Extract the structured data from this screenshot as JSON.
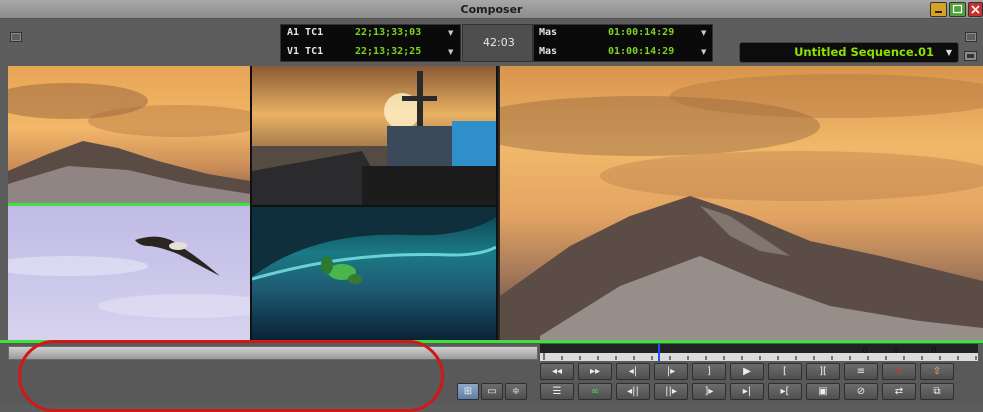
{
  "window": {
    "title": "Composer"
  },
  "source_tc": {
    "rows": [
      {
        "track": "A1 TC1",
        "value": "22;13;33;03"
      },
      {
        "track": "V1 TC1",
        "value": "22;13;32;25"
      }
    ],
    "center": "42:03"
  },
  "record_tc": {
    "rows": [
      {
        "track": "Mas",
        "value": "01:00:14:29"
      },
      {
        "track": "Mas",
        "value": "01:00:14:29"
      }
    ]
  },
  "sequence": {
    "name": "Untitled Sequence.01"
  },
  "ruler": {
    "marks": [
      "0",
      "0",
      "0"
    ]
  },
  "colors": {
    "accent_green": "#3ee13e",
    "timecode_green": "#7ed321",
    "annotation_red": "#d11717"
  },
  "controls": {
    "row1": [
      {
        "name": "fast-rewind-icon",
        "glyph": "◂◂"
      },
      {
        "name": "fast-forward-icon",
        "glyph": "▸▸"
      },
      {
        "name": "step-back-icon",
        "glyph": "◂|"
      },
      {
        "name": "step-forward-icon",
        "glyph": "|▸"
      },
      {
        "name": "mark-out-icon",
        "glyph": "]"
      },
      {
        "name": "play-icon",
        "glyph": "▶"
      },
      {
        "name": "mark-in-icon",
        "glyph": "["
      },
      {
        "name": "mark-clip-icon",
        "glyph": "]["
      },
      {
        "name": "splice-in-icon",
        "glyph": "≡"
      },
      {
        "name": "lift-icon",
        "glyph": "⇧"
      },
      {
        "name": "extract-icon",
        "glyph": "⇧"
      }
    ],
    "row2": [
      {
        "name": "quad-split-icon",
        "glyph": "⊞"
      },
      {
        "name": "source-record-icon",
        "glyph": "▭"
      },
      {
        "name": "sync-icon",
        "glyph": "≑"
      },
      {
        "name": "clip-list-icon",
        "glyph": "☰"
      },
      {
        "name": "loop-icon",
        "glyph": "∞"
      },
      {
        "name": "step-back-frames-icon",
        "glyph": "◂||"
      },
      {
        "name": "step-forward-frames-icon",
        "glyph": "||▸"
      },
      {
        "name": "go-to-out-icon",
        "glyph": "]▸"
      },
      {
        "name": "play-in-out-icon",
        "glyph": "▸|"
      },
      {
        "name": "go-to-in-icon",
        "glyph": "▸["
      },
      {
        "name": "overwrite-icon",
        "glyph": "▣"
      },
      {
        "name": "clear-marks-icon",
        "glyph": "⊘"
      },
      {
        "name": "match-frame-icon",
        "glyph": "⇄"
      },
      {
        "name": "copy-icon",
        "glyph": "⧉"
      }
    ]
  }
}
